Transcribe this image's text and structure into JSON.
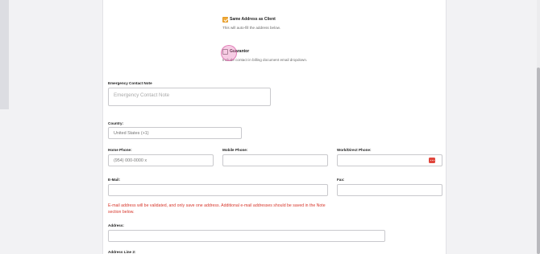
{
  "address_options": {
    "same_as_client_label": "Same Address as Client",
    "same_as_client_hint": "This will auto-fill the address below.",
    "guarantor_label": "Guarantor",
    "guarantor_hint": "Include contact in billing document email dropdown."
  },
  "fields": {
    "emergency_note": {
      "label": "Emergency Contact Note",
      "placeholder": "Emergency Contact Note"
    },
    "country": {
      "label": "Country:",
      "value": "United States (+1)"
    },
    "home_phone": {
      "label": "Home Phone:",
      "placeholder": "(954) 000-0000 x"
    },
    "mobile_phone": {
      "label": "Mobile Phone:",
      "value": ""
    },
    "work_phone": {
      "label": "Work/Direct Phone:",
      "value": ""
    },
    "email": {
      "label": "E-Mail:",
      "value": ""
    },
    "fax": {
      "label": "Fax:",
      "value": ""
    },
    "address": {
      "label": "Address:",
      "value": ""
    },
    "address_line2": {
      "label": "Address Line 2:"
    }
  },
  "email_warning": "E-mail address will be validated, and only save one address. Additional e-mail addresses should be saved in the Note section below.",
  "colors": {
    "accent_checkbox": "#f0a93a",
    "warning_text": "#d7372c",
    "autofill_icon": "#e0463c"
  }
}
